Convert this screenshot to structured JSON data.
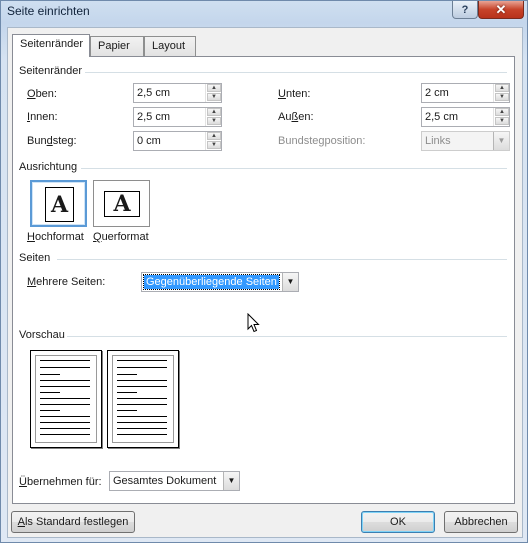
{
  "window": {
    "title": "Seite einrichten"
  },
  "titlebar": {
    "help_glyph": "?",
    "close_glyph": "✕"
  },
  "tabs": [
    {
      "label": "Seitenränder",
      "active": true
    },
    {
      "label": "Papier",
      "active": false
    },
    {
      "label": "Layout",
      "active": false
    }
  ],
  "margins": {
    "heading": "Seitenränder",
    "top": {
      "label": "Oben:",
      "accel": "O",
      "rest": "ben:",
      "value": "2,5 cm"
    },
    "bottom": {
      "label": "Unten:",
      "accel": "U",
      "rest": "nten:",
      "value": "2 cm"
    },
    "inner": {
      "label": "Innen:",
      "accel": "I",
      "rest": "nnen:",
      "value": "2,5 cm"
    },
    "outer": {
      "label": "Außen:",
      "pre": "Au",
      "accel": "ß",
      "rest": "en:",
      "value": "2,5 cm"
    },
    "gutter": {
      "label": "Bundsteg:",
      "pre": "Bun",
      "accel": "d",
      "rest": "steg:",
      "value": "0 cm"
    },
    "gutter_position": {
      "label": "Bundstegposition:",
      "value": "Links",
      "disabled": true
    }
  },
  "orientation": {
    "heading": "Ausrichtung",
    "portrait": {
      "label": "Hochformat",
      "accel": "H",
      "rest": "ochformat",
      "glyph": "A",
      "selected": true
    },
    "landscape": {
      "label": "Querformat",
      "accel": "Q",
      "rest": "uerformat",
      "glyph": "A",
      "selected": false
    }
  },
  "pages": {
    "heading": "Seiten",
    "multiple_label": "Mehrere Seiten:",
    "multiple_accel": "M",
    "multiple_rest": "ehrere Seiten:",
    "multiple_value": "Gegenüberliegende Seiten"
  },
  "preview": {
    "heading": "Vorschau"
  },
  "apply": {
    "label": "Übernehmen für:",
    "accel": "Ü",
    "rest": "bernehmen für:",
    "value": "Gesamtes Dokument"
  },
  "buttons": {
    "set_default": "Als Standard festlegen",
    "set_default_accel": "A",
    "set_default_rest": "ls Standard festlegen",
    "ok": "OK",
    "cancel": "Abbrechen"
  },
  "icons": {
    "spin_up": "▲",
    "spin_down": "▼",
    "dropdown": "▼"
  }
}
